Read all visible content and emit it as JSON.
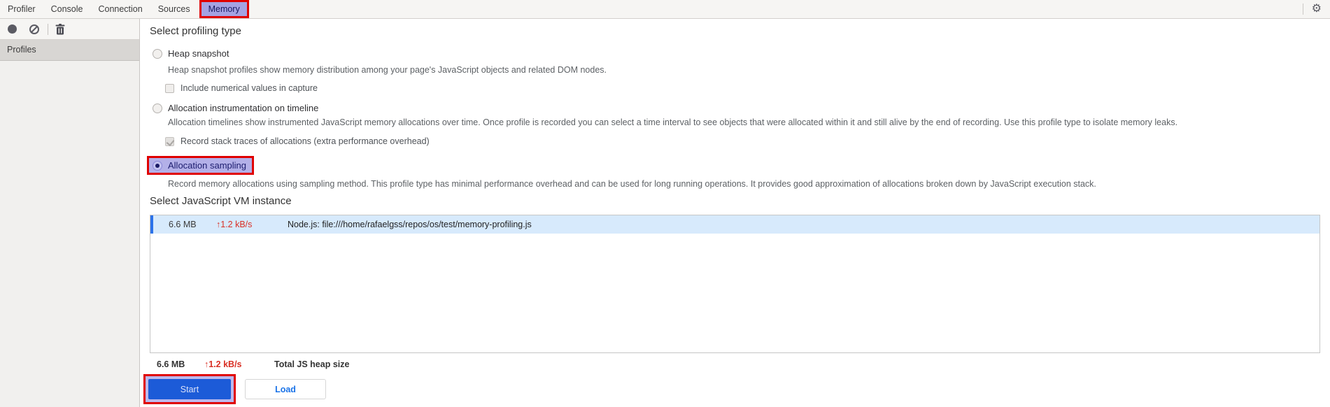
{
  "tabs": {
    "items": [
      "Profiler",
      "Console",
      "Connection",
      "Sources",
      "Memory"
    ],
    "selected": "Memory"
  },
  "icons": {
    "gear_glyph": "⚙"
  },
  "sidebar": {
    "profiles_header": "Profiles"
  },
  "profiling": {
    "heading": "Select profiling type",
    "options": [
      {
        "label": "Heap snapshot",
        "description": "Heap snapshot profiles show memory distribution among your page's JavaScript objects and related DOM nodes.",
        "selected": false,
        "sub_checkbox": {
          "label": "Include numerical values in capture",
          "checked": false
        }
      },
      {
        "label": "Allocation instrumentation on timeline",
        "description": "Allocation timelines show instrumented JavaScript memory allocations over time. Once profile is recorded you can select a time interval to see objects that were allocated within it and still alive by the end of recording. Use this profile type to isolate memory leaks.",
        "selected": false,
        "sub_checkbox": {
          "label": "Record stack traces of allocations (extra performance overhead)",
          "checked": true
        }
      },
      {
        "label": "Allocation sampling",
        "description": "Record memory allocations using sampling method. This profile type has minimal performance overhead and can be used for long running operations. It provides good approximation of allocations broken down by JavaScript execution stack.",
        "selected": true
      }
    ]
  },
  "vm": {
    "heading": "Select JavaScript VM instance",
    "instances": [
      {
        "heap_size": "6.6 MB",
        "rate": "↑1.2 kB/s",
        "name": "Node.js: file:///home/rafaelgss/repos/os/test/memory-profiling.js",
        "selected": true
      }
    ],
    "total": {
      "heap_size": "6.6 MB",
      "rate": "↑1.2 kB/s",
      "label": "Total JS heap size"
    }
  },
  "actions": {
    "start_label": "Start",
    "load_label": "Load"
  },
  "colors": {
    "annotation_red": "#e00000",
    "tab_selected_bg": "#a5a2e3",
    "selected_row_bg": "#d7eafc",
    "row_accent_blue": "#2b72ea",
    "rate_red": "#d93025",
    "start_button_blue": "#1c5bd8",
    "load_text_blue": "#1a73e8"
  }
}
